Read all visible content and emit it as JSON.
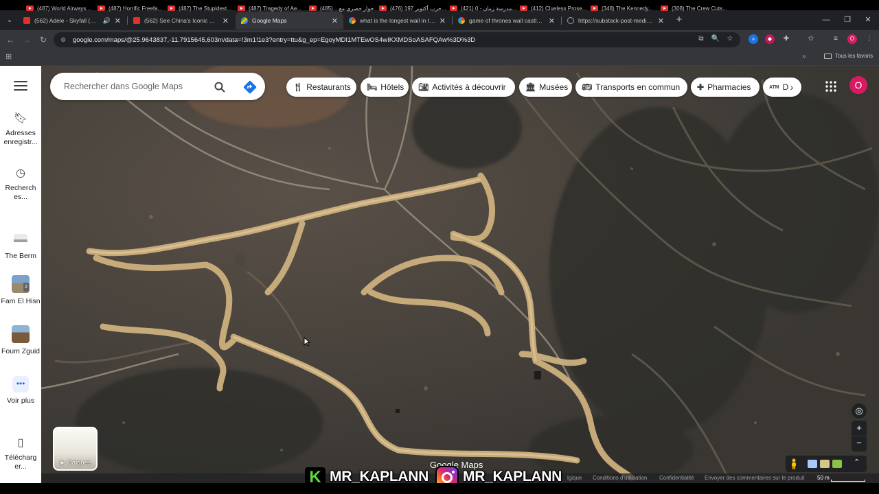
{
  "browser": {
    "tabs": [
      {
        "label": "(562) Adele - Skyfall (Official",
        "favicon": "youtube-favicon",
        "audio": true
      },
      {
        "label": "(562) See China's Iconic Great W",
        "favicon": "youtube-favicon"
      },
      {
        "label": "Google Maps",
        "favicon": "maps-favicon",
        "active": true
      },
      {
        "label": "what is the longest wall in the w",
        "favicon": "google-favicon"
      },
      {
        "label": "game of thrones wall castles m",
        "favicon": "google-favicon"
      },
      {
        "label": "https://substack-post-media.s3",
        "favicon": "globe-favicon"
      }
    ],
    "url": "google.com/maps/@25.9643837,-11.7915645,603m/data=!3m1!1e3?entry=ttu&g_ep=EgoyMDI1MTEwOS4wIKXMDSoASAFQAw%3D%3D",
    "bookmarks": [
      "(487) World Airways...",
      "(487) Horrific Freefa...",
      "(487) The Stupidest...",
      "(487) Tragedy of Ae...",
      "حوار حصري مع... (485)",
      "(476) حرب أكتوبر 197...",
      "(421) مدرسة زمان - 0...",
      "(412) Clueless Prose...",
      "(348) The Kennedy...",
      "(308) The Crew Cuts..."
    ],
    "all_bookmarks": "Tous les favoris",
    "profile_initial": "O"
  },
  "maps": {
    "search_placeholder": "Rechercher dans Google Maps",
    "rail": {
      "saved": "Adresses enregistr...",
      "recents": "Recherch es...",
      "places": [
        {
          "label": "The Berm"
        },
        {
          "label": "Fam El Hisn",
          "badge": "2"
        },
        {
          "label": "Foum Zguid"
        }
      ],
      "more": "Voir plus",
      "download": "Télécharg er..."
    },
    "chips": [
      {
        "label": "Restaurants",
        "icon": "fork-knife-icon"
      },
      {
        "label": "Hôtels",
        "icon": "bed-icon"
      },
      {
        "label": "Activités à découvrir",
        "icon": "camera-icon"
      },
      {
        "label": "Musées",
        "icon": "museum-icon"
      },
      {
        "label": "Transports en commun",
        "icon": "bus-icon"
      },
      {
        "label": "Pharmacies",
        "icon": "pharmacy-icon"
      },
      {
        "label": "D",
        "icon": "atm-icon",
        "icon_text": "ATM"
      }
    ],
    "layers_label": "Calques",
    "logo": "Google Maps",
    "footer": {
      "terms": "Conditions d'utilisation",
      "privacy": "Confidentialité",
      "feedback": "Envoyer des commentaires sur le produit",
      "belgique": "lgique",
      "scale": "50 m"
    },
    "avatar_initial": "O",
    "colors": {
      "accent_blue": "#1a73e8",
      "avatar": "#d81b60",
      "terrain": "#3d3a35",
      "trench": "#cdb07e"
    }
  },
  "watermark": {
    "handle_1": "MR_KAPLANN",
    "handle_2": "MR_KAPLANN",
    "k_letter": "K"
  }
}
